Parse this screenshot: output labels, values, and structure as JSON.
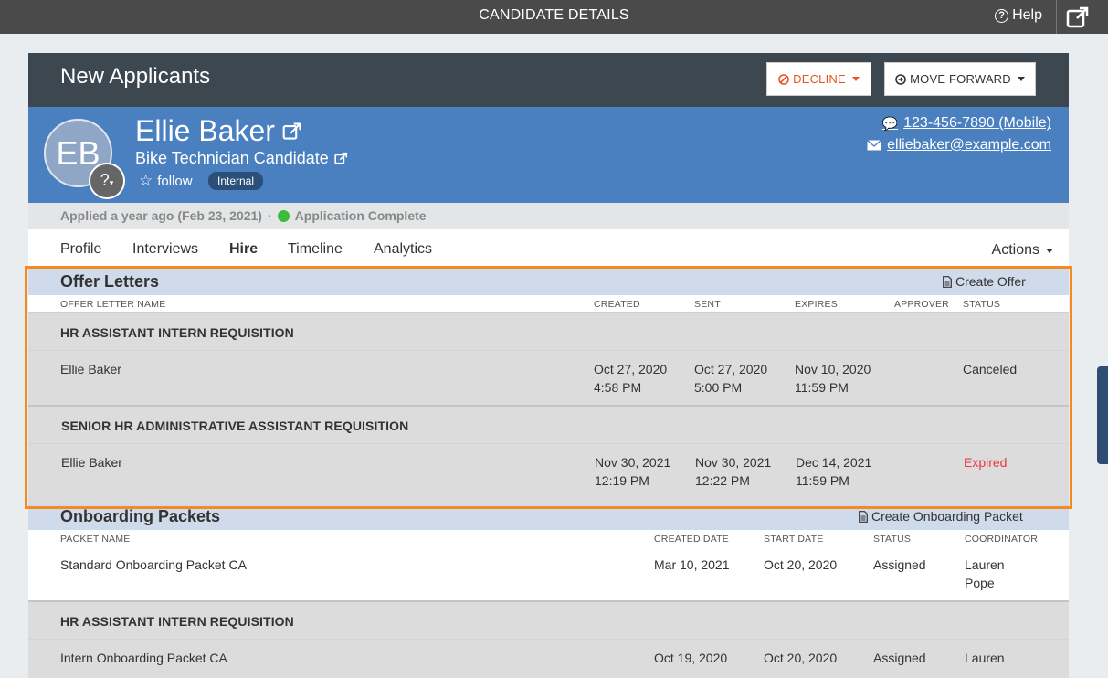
{
  "topbar": {
    "title": "CANDIDATE DETAILS",
    "help": "Help"
  },
  "header": {
    "stage": "New Applicants",
    "decline": "DECLINE",
    "move_forward": "MOVE FORWARD"
  },
  "candidate": {
    "initials": "EB",
    "badge": "?",
    "name": "Ellie Baker",
    "job": "Bike Technician Candidate",
    "follow": "follow",
    "tag": "Internal",
    "phone": "123-456-7890 (Mobile)",
    "email": "elliebaker@example.com"
  },
  "status": {
    "applied": "Applied a year ago (Feb 23, 2021)",
    "sep": "·",
    "complete": "Application Complete"
  },
  "tabs": [
    "Profile",
    "Interviews",
    "Hire",
    "Timeline",
    "Analytics"
  ],
  "actions_label": "Actions",
  "offer_letters": {
    "title": "Offer Letters",
    "action": "Create Offer",
    "columns": [
      "OFFER LETTER NAME",
      "CREATED",
      "SENT",
      "EXPIRES",
      "APPROVER",
      "STATUS"
    ],
    "groups": [
      {
        "requisition": "HR ASSISTANT INTERN REQUISITION",
        "row": {
          "name": "Ellie Baker",
          "created_date": "Oct 27, 2020",
          "created_time": "4:58 PM",
          "sent_date": "Oct 27, 2020",
          "sent_time": "5:00 PM",
          "expires_date": "Nov 10, 2020",
          "expires_time": "11:59 PM",
          "approver": "",
          "status": "Canceled"
        }
      },
      {
        "requisition": "SENIOR HR ADMINISTRATIVE ASSISTANT REQUISITION",
        "row": {
          "name": "Ellie Baker",
          "created_date": "Nov 30, 2021",
          "created_time": "12:19 PM",
          "sent_date": "Nov 30, 2021",
          "sent_time": "12:22 PM",
          "expires_date": "Dec 14, 2021",
          "expires_time": "11:59 PM",
          "approver": "",
          "status": "Expired"
        }
      }
    ]
  },
  "onboarding": {
    "title": "Onboarding Packets",
    "action": "Create Onboarding Packet",
    "columns": [
      "PACKET NAME",
      "CREATED DATE",
      "START DATE",
      "STATUS",
      "COORDINATOR"
    ],
    "row1": {
      "name": "Standard Onboarding Packet CA",
      "created": "Mar 10, 2021",
      "start": "Oct 20, 2020",
      "status": "Assigned",
      "coordinator_first": "Lauren",
      "coordinator_last": "Pope"
    },
    "requisition": "HR ASSISTANT INTERN REQUISITION",
    "row2": {
      "name": "Intern Onboarding Packet CA",
      "created": "Oct 19, 2020",
      "start": "Oct 20, 2020",
      "status": "Assigned",
      "coordinator_first": "Lauren"
    }
  },
  "colors": {
    "accent_blue": "#4a7fc0",
    "highlight": "#f58a1f",
    "decline": "#e8541e",
    "expired": "#e8383d"
  }
}
